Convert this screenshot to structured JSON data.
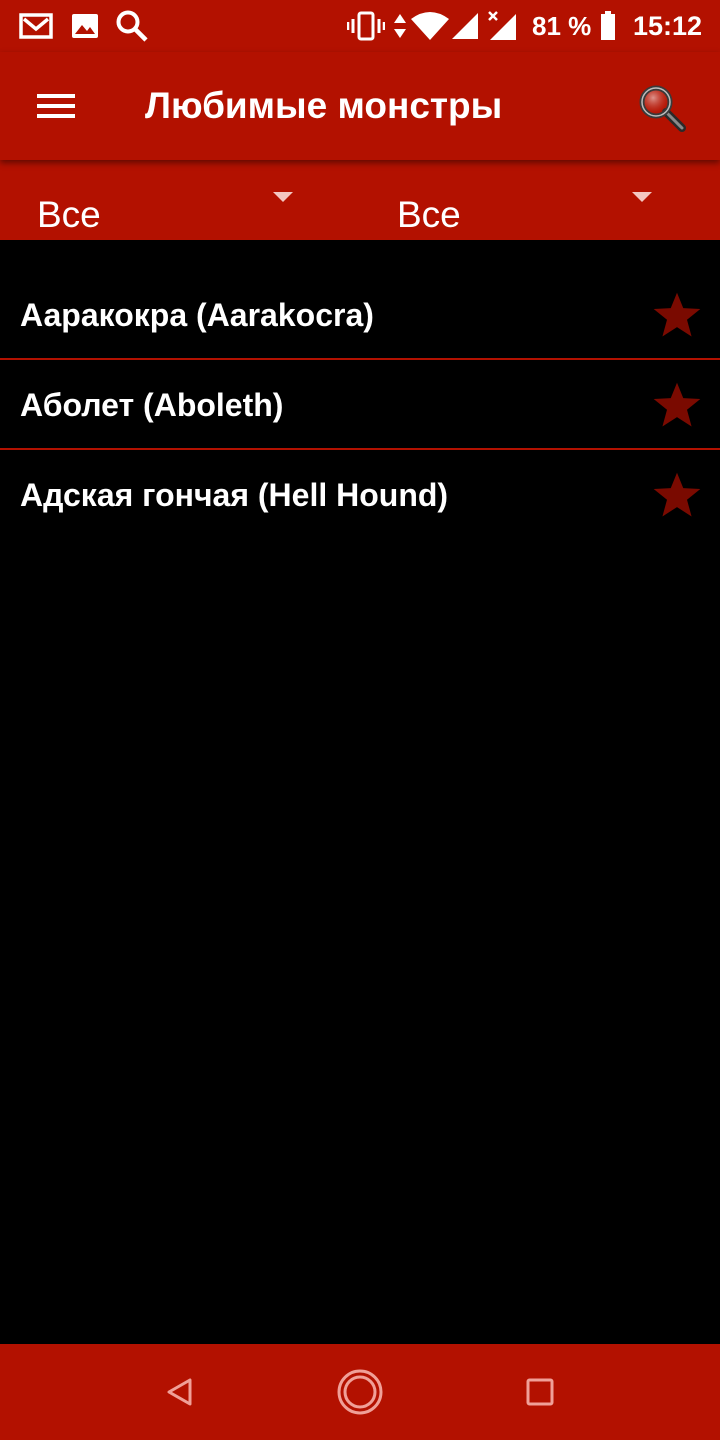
{
  "status_bar": {
    "battery_text": "81 %",
    "time": "15:12",
    "icons": [
      "gmail-icon",
      "image-icon",
      "search-icon",
      "vibrate-icon",
      "data-arrows-icon",
      "wifi-icon",
      "signal-icon",
      "signal-no-data-icon",
      "battery-icon"
    ]
  },
  "app_bar": {
    "title": "Любимые монстры",
    "menu_icon": "hamburger-menu-icon",
    "search_icon": "magnifier-icon"
  },
  "filters": [
    {
      "value": "Все"
    },
    {
      "value": "Все"
    }
  ],
  "monsters": [
    {
      "label": "Ааракокра (Aarakocra)",
      "favorite": true
    },
    {
      "label": "Аболет (Aboleth)",
      "favorite": true
    },
    {
      "label": "Адская гончая (Hell Hound)",
      "favorite": true
    }
  ],
  "nav_bar": {
    "icons": [
      "back-icon",
      "home-icon",
      "recents-icon"
    ]
  },
  "colors": {
    "accent": "#b31100",
    "background": "#000000",
    "star": "#7a0a00",
    "nav_icon": "#f0a098"
  }
}
